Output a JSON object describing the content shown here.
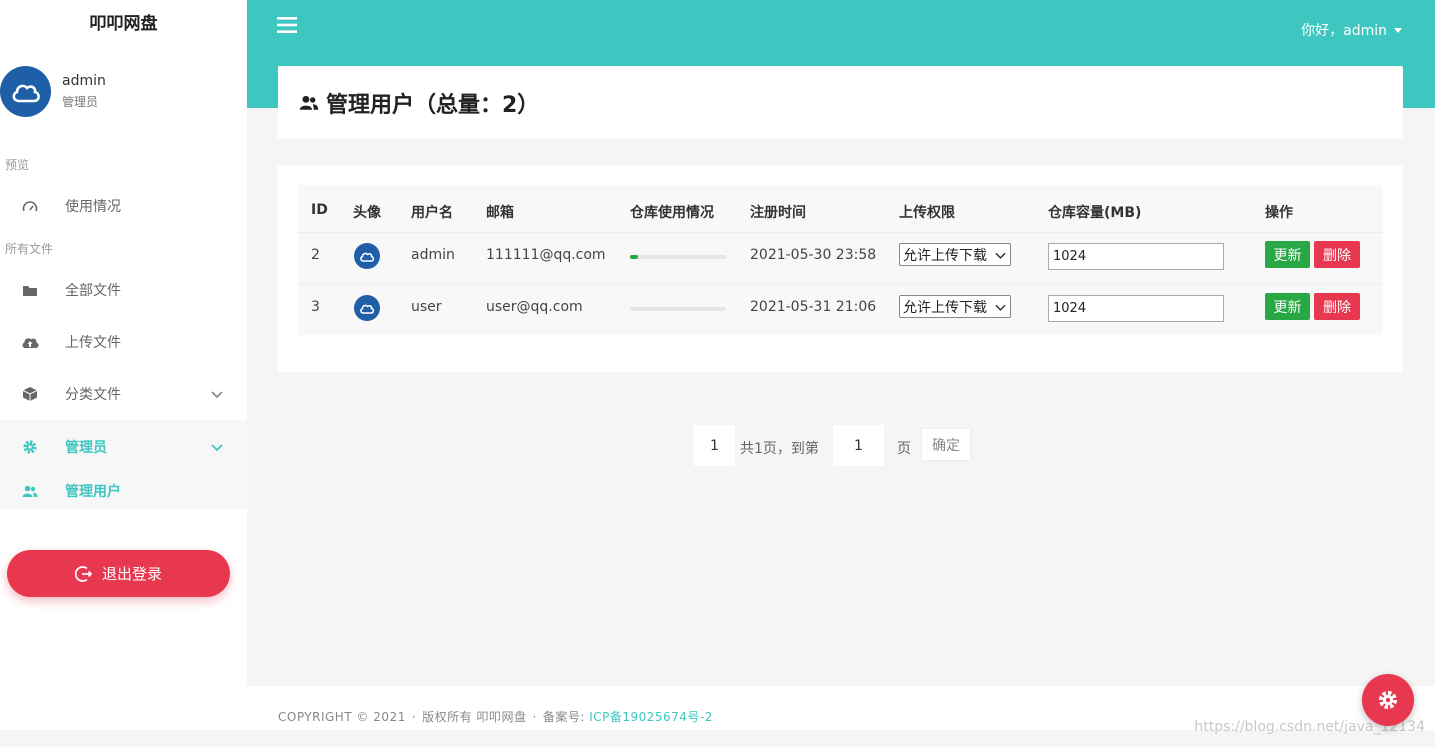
{
  "app": {
    "brand": "叩叩网盘"
  },
  "user": {
    "name": "admin",
    "role": "管理员"
  },
  "sidebar": {
    "section_preview": "预览",
    "usage": "使用情况",
    "section_files": "所有文件",
    "all_files": "全部文件",
    "upload_files": "上传文件",
    "category_files": "分类文件",
    "admin": "管理员",
    "manage_users": "管理用户",
    "logout": "退出登录"
  },
  "header": {
    "greeting": "你好，admin"
  },
  "page": {
    "title": "管理用户（总量：2）"
  },
  "table": {
    "headers": [
      "ID",
      "头像",
      "用户名",
      "邮箱",
      "仓库使用情况",
      "注册时间",
      "上传权限",
      "仓库容量(MB)",
      "操作"
    ],
    "rows": [
      {
        "id": "2",
        "username": "admin",
        "email": "111111@qq.com",
        "usage_fraction": 0.08,
        "registered": "2021-05-30 23:58",
        "permission": "允许上传下载",
        "capacity": "1024",
        "update_label": "更新",
        "delete_label": "删除"
      },
      {
        "id": "3",
        "username": "user",
        "email": "user@qq.com",
        "usage_fraction": 0,
        "registered": "2021-05-31 21:06",
        "permission": "允许上传下载",
        "capacity": "1024",
        "update_label": "更新",
        "delete_label": "删除"
      }
    ]
  },
  "pagination": {
    "current_page": "1",
    "total_text": "共1页，到第",
    "goto_value": "1",
    "page_unit": "页",
    "confirm": "确定"
  },
  "footer": {
    "copyright": "COPYRIGHT © 2021",
    "rights": "版权所有 叩叩网盘",
    "icp_label": "备案号:",
    "icp_number": "ICP备19025674号-2"
  },
  "watermark": "https://blog.csdn.net/java_12134",
  "colors": {
    "accent": "#3ec7c0",
    "danger": "#e8384f",
    "success": "#28a745",
    "avatar": "#1f5fa8"
  }
}
